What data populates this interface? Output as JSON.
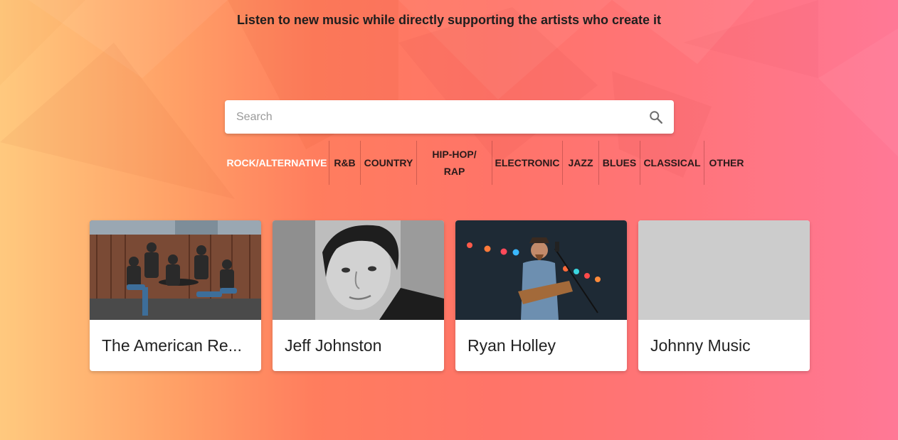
{
  "tagline": "Listen to new music while directly supporting the artists who create it",
  "search": {
    "placeholder": "Search",
    "value": "",
    "icon": "search-icon"
  },
  "genres": [
    {
      "label": "ROCK/ALTERNATIVE",
      "active": true
    },
    {
      "label": "R&B",
      "active": false
    },
    {
      "label": "COUNTRY",
      "active": false
    },
    {
      "label": "HIP-HOP/RAP",
      "active": false
    },
    {
      "label": "ELECTRONIC",
      "active": false
    },
    {
      "label": "JAZZ",
      "active": false
    },
    {
      "label": "BLUES",
      "active": false
    },
    {
      "label": "CLASSICAL",
      "active": false
    },
    {
      "label": "OTHER",
      "active": false
    }
  ],
  "artists": [
    {
      "name": "The American Re...",
      "image": "band-photo"
    },
    {
      "name": "Jeff Johnston",
      "image": "portrait-photo"
    },
    {
      "name": "Ryan Holley",
      "image": "concert-photo"
    },
    {
      "name": "Johnny Music",
      "image": "placeholder"
    }
  ],
  "colors": {
    "active_genre": "#ffffff",
    "genre_text": "#2a1a1a",
    "placeholder_image": "#cccccc"
  }
}
